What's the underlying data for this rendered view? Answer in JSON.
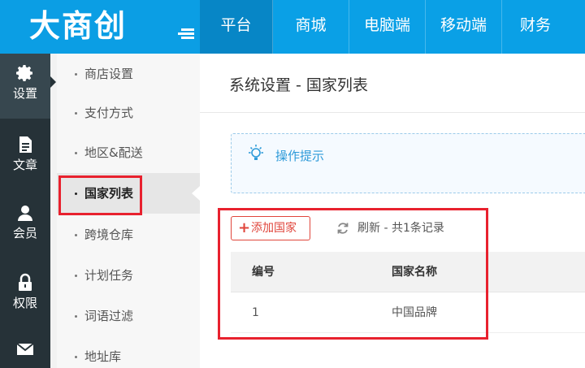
{
  "header": {
    "logo": "大商创",
    "nav": [
      {
        "label": "平台",
        "active": true
      },
      {
        "label": "商城"
      },
      {
        "label": "电脑端"
      },
      {
        "label": "移动端"
      },
      {
        "label": "财务"
      }
    ]
  },
  "sidebar": {
    "items": [
      {
        "label": "设置",
        "icon": "gear-icon",
        "active": true
      },
      {
        "label": "文章",
        "icon": "document-icon"
      },
      {
        "label": "会员",
        "icon": "user-icon"
      },
      {
        "label": "权限",
        "icon": "lock-icon"
      },
      {
        "label": "",
        "icon": "mail-icon"
      }
    ]
  },
  "submenu": {
    "items": [
      {
        "label": "商店设置"
      },
      {
        "label": "支付方式"
      },
      {
        "label": "地区&配送"
      },
      {
        "label": "国家列表",
        "active": true
      },
      {
        "label": "跨境仓库"
      },
      {
        "label": "计划任务"
      },
      {
        "label": "词语过滤"
      },
      {
        "label": "地址库"
      }
    ]
  },
  "main": {
    "title": "系统设置 - 国家列表",
    "tips_label": "操作提示",
    "add_button": "添加国家",
    "refresh_label": "刷新 - 共1条记录",
    "table": {
      "columns": [
        "编号",
        "国家名称"
      ],
      "rows": [
        [
          "1",
          "中国品牌"
        ]
      ]
    }
  },
  "colors": {
    "header": "#0aa0e6",
    "nav_active": "#0786c6",
    "sidebar": "#263238",
    "highlight": "#e8212e",
    "add_button": "#e0463c",
    "tips_text": "#2f9bd9"
  }
}
